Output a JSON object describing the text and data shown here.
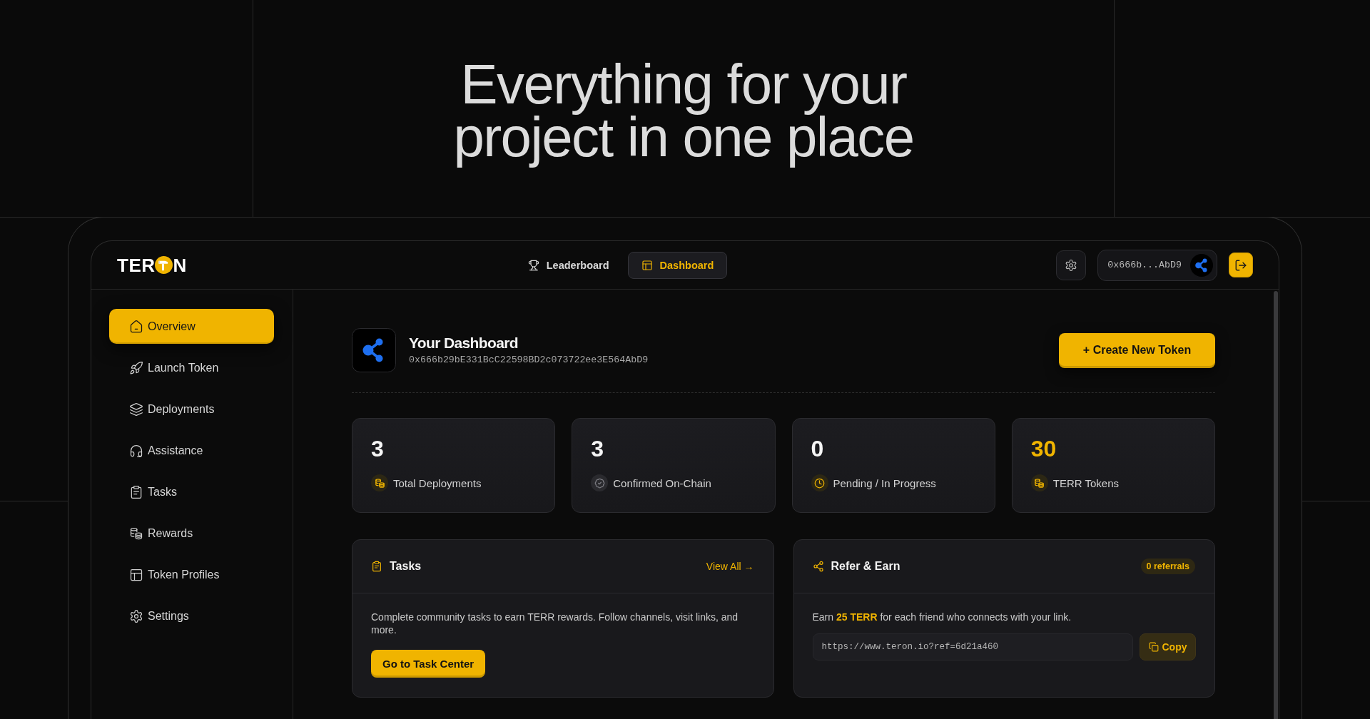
{
  "hero": {
    "headline": "Everything for your project in one place"
  },
  "topbar": {
    "logo_start": "TER",
    "logo_end": "N",
    "nav": [
      {
        "label": "Leaderboard",
        "selected": false
      },
      {
        "label": "Dashboard",
        "selected": true
      }
    ],
    "wallet_address": "0x666b...AbD9"
  },
  "sidebar": {
    "items": [
      {
        "label": "Overview",
        "selected": true
      },
      {
        "label": "Launch Token",
        "selected": false
      },
      {
        "label": "Deployments",
        "selected": false
      },
      {
        "label": "Assistance",
        "selected": false
      },
      {
        "label": "Tasks",
        "selected": false
      },
      {
        "label": "Rewards",
        "selected": false
      },
      {
        "label": "Token Profiles",
        "selected": false
      },
      {
        "label": "Settings",
        "selected": false
      }
    ]
  },
  "dashboard": {
    "title": "Your Dashboard",
    "address": "0x666b29bE331BcC22598BD2c073722ee3E564AbD9",
    "create_button": "+ Create New Token"
  },
  "stats": [
    {
      "value": "3",
      "label": "Total Deployments",
      "highlighted": false
    },
    {
      "value": "3",
      "label": "Confirmed On-Chain",
      "highlighted": false
    },
    {
      "value": "0",
      "label": "Pending / In Progress",
      "highlighted": false
    },
    {
      "value": "30",
      "label": "TERR Tokens",
      "highlighted": true
    }
  ],
  "tasks_panel": {
    "title": "Tasks",
    "link": "View All →",
    "description": "Complete community tasks to earn TERR rewards. Follow channels, visit links, and more.",
    "button": "Go to Task Center"
  },
  "refer_panel": {
    "title": "Refer & Earn",
    "badge": "0 referrals",
    "description": "Earn **25 TERR** for each friend who connects with your link.",
    "link_value": "https://www.teron.io?ref=6d21a460",
    "copy_button": "Copy"
  }
}
